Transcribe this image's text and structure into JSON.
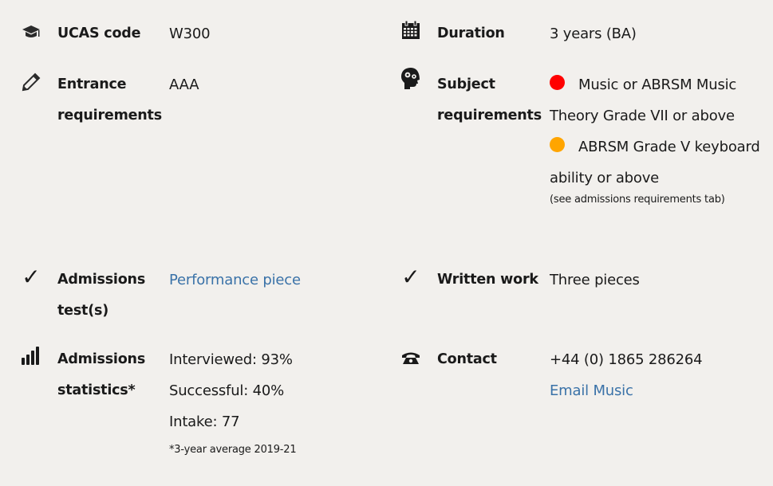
{
  "items": {
    "ucas": {
      "icon": "graduation-cap-icon",
      "label": "UCAS code",
      "value": "W300"
    },
    "duration": {
      "icon": "calendar-icon",
      "label": "Duration",
      "value": "3 years (BA)"
    },
    "entrance": {
      "icon": "pencil-icon",
      "label_line1": "Entrance",
      "label_line2": "requirements",
      "value": "AAA"
    },
    "subject": {
      "icon": "head-gears-icon",
      "label_line1": "Subject",
      "label_line2": "requirements",
      "requirements": [
        {
          "status": "essential",
          "color": "#ff0000",
          "text_line1": "Music or ABRSM Music",
          "text_line2": "Theory Grade VII or above"
        },
        {
          "status": "recommended",
          "color": "#ffa500",
          "text_line1": "ABRSM Grade V keyboard",
          "text_line2": "ability or above"
        }
      ],
      "note": "(see admissions requirements tab)"
    },
    "admissions_test": {
      "icon": "checkmark-icon",
      "label_line1": "Admissions",
      "label_line2": "test(s)",
      "value": "Performance piece"
    },
    "written_work": {
      "icon": "checkmark-icon",
      "label": "Written work",
      "value": "Three pieces"
    },
    "statistics": {
      "icon": "bar-chart-icon",
      "label_line1": "Admissions",
      "label_line2": "statistics*",
      "interviewed": "Interviewed: 93%",
      "successful": "Successful: 40%",
      "intake": "Intake: 77",
      "note": "*3-year average 2019-21"
    },
    "contact": {
      "icon": "telephone-icon",
      "label": "Contact",
      "phone": "+44 (0) 1865 286264",
      "email_link": "Email Music"
    }
  },
  "colors": {
    "background": "#f2f0ed",
    "link": "#3a72a8",
    "essential": "#ff0000",
    "recommended": "#ffa500"
  }
}
